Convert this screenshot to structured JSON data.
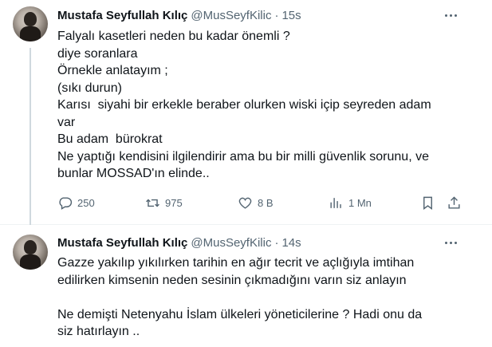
{
  "tweets": [
    {
      "author_name": "Mustafa Seyfullah Kılıç",
      "handle": "@MusSeyfKilic",
      "separator": "·",
      "time": "15s",
      "lines": [
        "Falyalı kasetleri neden bu kadar önemli ?",
        "diye soranlara",
        "Örnekle anlatayım ;",
        "(sıkı durun)",
        "Karısı  siyahi bir erkekle beraber olurken wiski içip seyreden adam",
        "var",
        "Bu adam  bürokrat",
        "Ne yaptığı kendisini ilgilendirir ama bu bir milli güvenlik sorunu, ve",
        "bunlar MOSSAD'ın elinde.."
      ],
      "stats": {
        "replies": "250",
        "retweets": "975",
        "likes": "8 B",
        "views": "1 Mn"
      }
    },
    {
      "author_name": "Mustafa Seyfullah Kılıç",
      "handle": "@MusSeyfKilic",
      "separator": "·",
      "time": "14s",
      "lines": [
        "Gazze yakılıp yıkılırken tarihin en ağır tecrit ve açlığıyla imtihan",
        "edilirken kimsenin neden sesinin çıkmadığını varın siz anlayın",
        "",
        "Ne demişti Netenyahu İslam ülkeleri yöneticilerine ? Hadi onu da",
        "siz hatırlayın .."
      ]
    }
  ],
  "icons": {
    "reply": "reply-icon",
    "retweet": "retweet-icon",
    "like": "heart-icon",
    "views": "views-icon",
    "bookmark": "bookmark-icon",
    "share": "share-icon",
    "more": "more-icon"
  }
}
